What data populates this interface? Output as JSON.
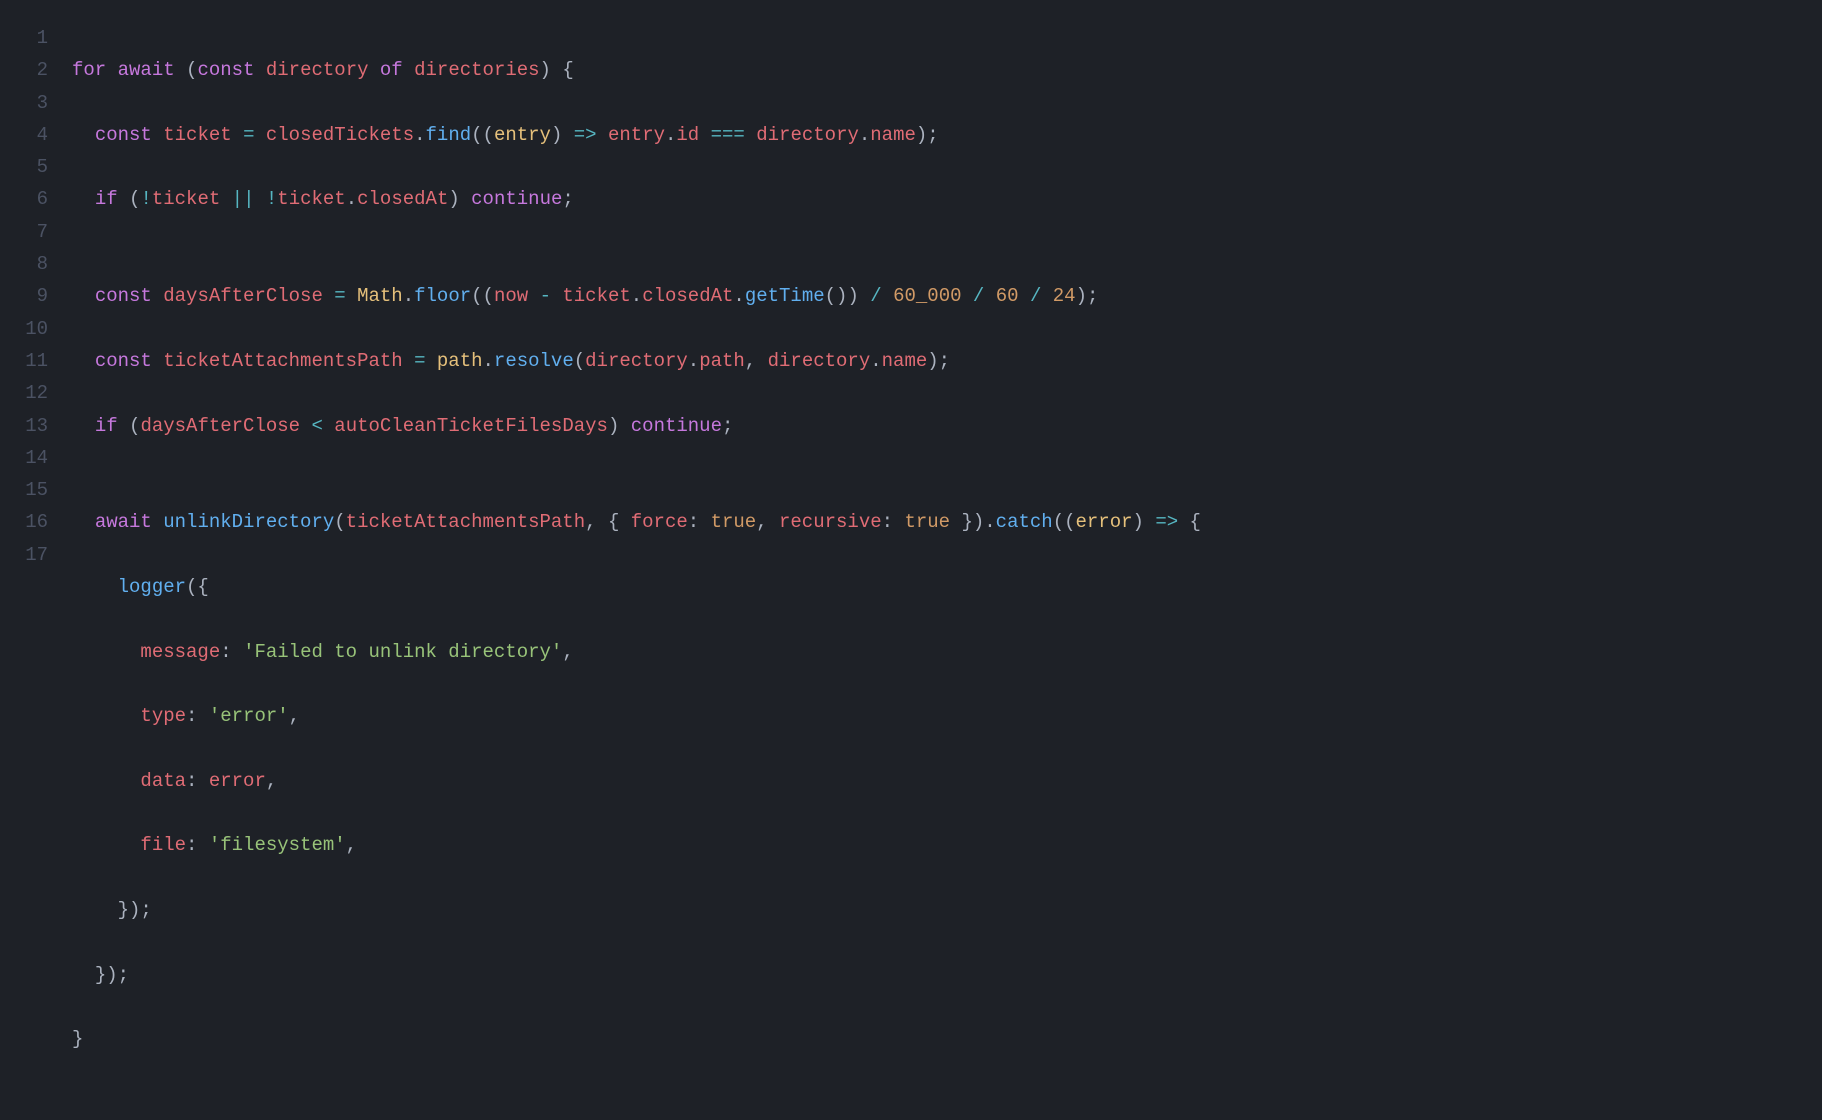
{
  "lineNumbers": [
    "1",
    "2",
    "3",
    "4",
    "5",
    "6",
    "7",
    "8",
    "9",
    "10",
    "11",
    "12",
    "13",
    "14",
    "15",
    "16",
    "17"
  ],
  "t": {
    "for": "for",
    "await": "await",
    "const": "const",
    "of": "of",
    "if": "if",
    "continue": "continue",
    "directory": "directory",
    "directories": "directories",
    "ticket": "ticket",
    "closedTickets": "closedTickets",
    "find": "find",
    "entry": "entry",
    "id": "id",
    "name": "name",
    "closedAt": "closedAt",
    "daysAfterClose": "daysAfterClose",
    "Math": "Math",
    "floor": "floor",
    "now": "now",
    "getTime": "getTime",
    "ticketAttachmentsPath": "ticketAttachmentsPath",
    "pathObj": "path",
    "resolve": "resolve",
    "pathProp": "path",
    "autoCleanTicketFilesDays": "autoCleanTicketFilesDays",
    "unlinkDirectory": "unlinkDirectory",
    "force": "force",
    "recursive": "recursive",
    "true": "true",
    "catch": "catch",
    "error": "error",
    "logger": "logger",
    "message": "message",
    "type": "type",
    "data": "data",
    "file": "file",
    "str_failed": "'Failed to unlink directory'",
    "str_error": "'error'",
    "str_filesystem": "'filesystem'",
    "n60000": "60_000",
    "n60": "60",
    "n24": "24",
    "arrow": "=>",
    "tripleeq": "===",
    "lt": "<",
    "bang": "!",
    "or": "||",
    "slash": "/",
    "minus": "-",
    "eq": "="
  }
}
